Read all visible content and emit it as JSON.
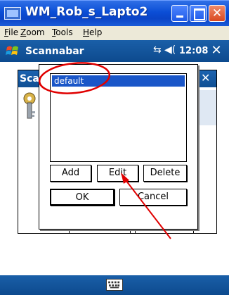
{
  "window": {
    "title": "WM_Rob_s_Lapto2",
    "buttons": {
      "minimize": "minimize",
      "maximize": "maximize",
      "close": "✕"
    }
  },
  "menubar": {
    "items": [
      "File",
      "Zoom",
      "Tools",
      "Help"
    ]
  },
  "taskbar": {
    "app_title": "Scannabar",
    "time": "12:08",
    "close_label": "✕",
    "connectivity_icon": "⇆",
    "volume_icon": "◀("
  },
  "background_window": {
    "title": "Sca",
    "close_label": "✕"
  },
  "dialog": {
    "list_items": [
      "default"
    ],
    "buttons": {
      "add": "Add",
      "edit": "Edit",
      "delete": "Delete",
      "ok": "OK",
      "cancel": "Cancel"
    }
  },
  "annotation_colors": {
    "circle": "#e00000",
    "arrow": "#e00000"
  }
}
